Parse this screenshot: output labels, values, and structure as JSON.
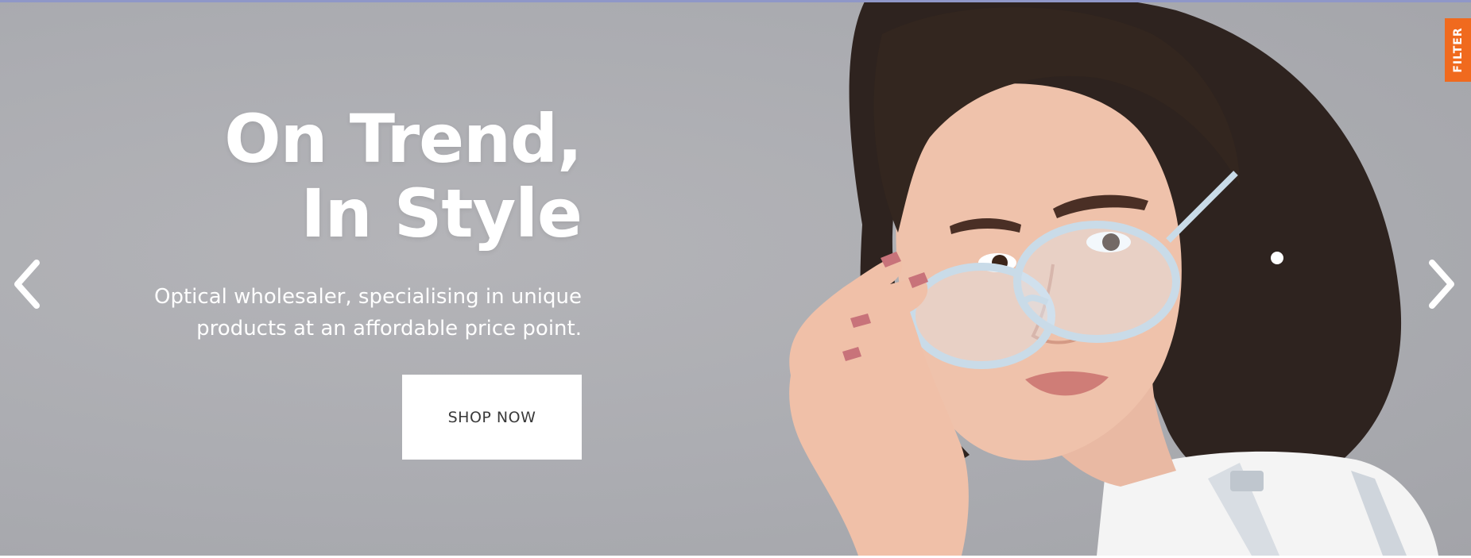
{
  "hero": {
    "headline_line1": "On Trend,",
    "headline_line2": "In Style",
    "subtitle_line1": "Optical wholesaler, specialising in unique",
    "subtitle_line2": "products at an affordable price point.",
    "cta_label": "SHOP NOW"
  },
  "carousel": {
    "prev_icon": "chevron-left-icon",
    "next_icon": "chevron-right-icon"
  },
  "filter_tab": {
    "label": "FILTER"
  },
  "colors": {
    "background": "#abacb1",
    "accent": "#f06a1e",
    "top_border": "#8f97c8",
    "button_bg": "#ffffff",
    "button_text": "#3a3a3a",
    "headline_text": "#ffffff"
  }
}
